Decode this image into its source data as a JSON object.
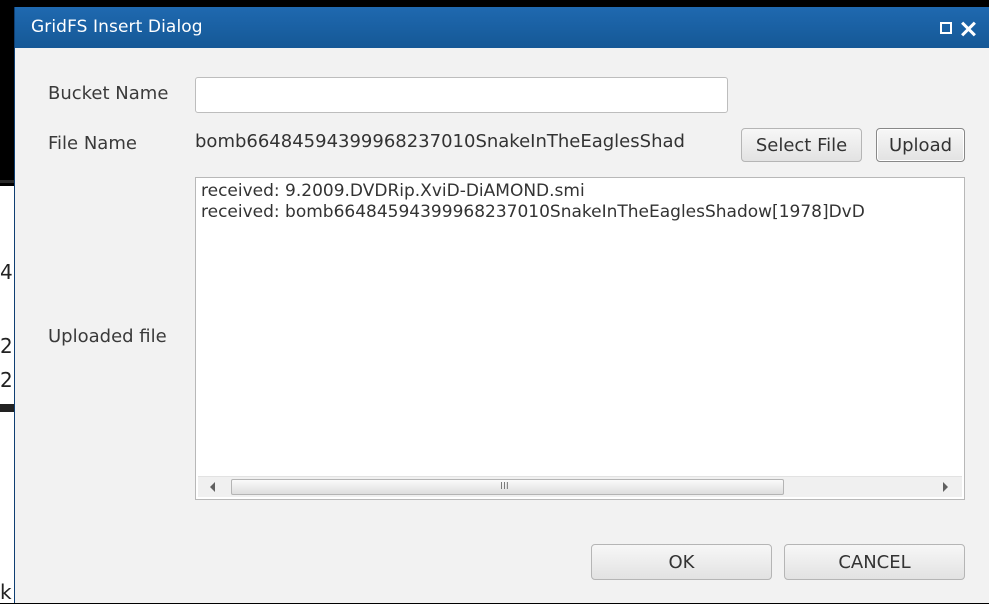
{
  "background": {
    "fragments": [
      "4(",
      "2(",
      "2.",
      "k"
    ]
  },
  "dialog": {
    "title": "GridFS Insert Dialog",
    "icons": [
      "maximize-icon",
      "close-icon"
    ]
  },
  "form": {
    "bucket_name_label": "Bucket Name",
    "bucket_name_value": "",
    "file_name_label": "File Name",
    "file_name_value": "bomb66484594399968237010SnakeInTheEaglesShad",
    "select_file_label": "Select File",
    "upload_label": "Upload",
    "uploaded_file_label": "Uploaded file",
    "uploaded_lines": [
      "received: 9.2009.DVDRip.XviD-DiAMOND.smi",
      "received: bomb66484594399968237010SnakeInTheEaglesShadow[1978]DvD"
    ],
    "scroll_grip": "III"
  },
  "footer": {
    "ok_label": "OK",
    "cancel_label": "CANCEL"
  },
  "colors": {
    "titlebar": "#1a5fa4",
    "dialog_bg": "#f2f2f2"
  }
}
